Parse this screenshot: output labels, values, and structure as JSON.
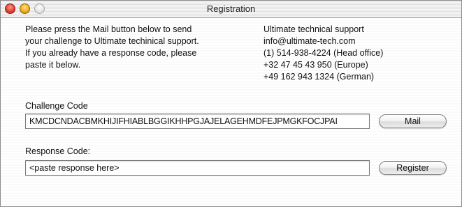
{
  "window": {
    "title": "Registration"
  },
  "instructions": [
    "Please press the Mail button below to send",
    "your challenge to Ultimate techinical support.",
    "If you already have a response code, please",
    "paste it below."
  ],
  "support": [
    "Ultimate technical support",
    "info@ultimate-tech.com",
    "(1) 514-938-4224 (Head office)",
    "+32 47 45 43 950 (Europe)",
    "+49 162 943 1324 (German)"
  ],
  "challenge": {
    "label": "Challenge Code",
    "value": "KMCDCNDACBMKHIJIFHIABLBGGIKHHPGJAJELAGEHMDFEJPMGKFOCJPAI",
    "button_label": "Mail"
  },
  "response": {
    "label": "Response Code:",
    "value": "<paste response here>",
    "button_label": "Register"
  }
}
